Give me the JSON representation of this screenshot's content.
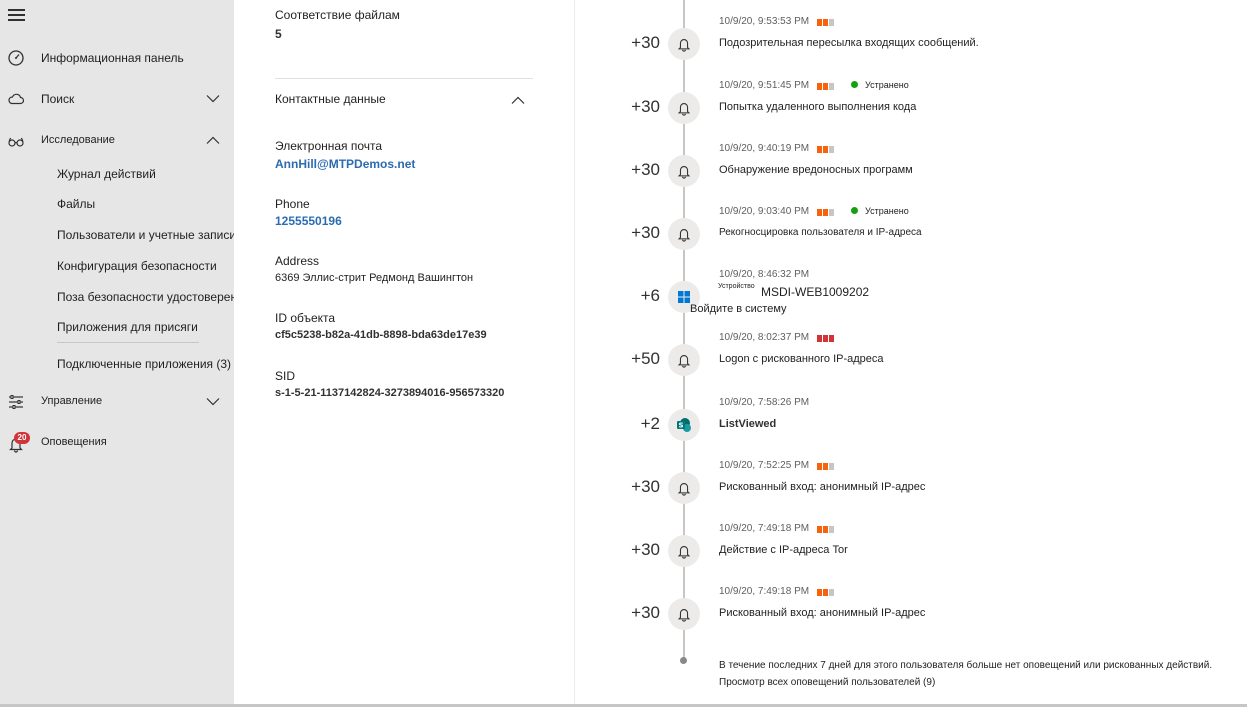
{
  "nav": {
    "items": [
      {
        "label": "Информационная панель",
        "icon": "gauge-icon"
      },
      {
        "label": "Поиск",
        "icon": "cloud-icon"
      },
      {
        "label": "Исследование",
        "icon": "glasses-icon"
      },
      {
        "label": "Управление",
        "icon": "sliders-icon"
      },
      {
        "label": "Оповещения",
        "icon": "bell-icon"
      }
    ],
    "sub_items": [
      "Журнал действий",
      "Файлы",
      "Пользователи и учетные записи",
      "Конфигурация безопасности",
      "Поза безопасности удостоверений",
      "Приложения для присяги",
      "Подключенные приложения (3)"
    ],
    "alerts_badge": "20"
  },
  "details": {
    "file_match_label": "Соответствие файлам",
    "file_match_value": "5",
    "contact_section": "Контактные данные",
    "email_label": "Электронная почта",
    "email_value": "AnnHill@MTPDemos.net",
    "phone_label": "Phone",
    "phone_value": "1255550196",
    "address_label": "Address",
    "address_value": "6369 Эллис-стрит Редмонд Вашингтон",
    "object_id_label": "ID объекта",
    "object_id_value": "cf5c5238-b82a-41db-8898-bda63de17e39",
    "sid_label": "SID",
    "sid_value": "s-1-5-21-1137142824-3273894016-956573320"
  },
  "timeline": {
    "events": [
      {
        "score": "+30",
        "time": "10/9/20, 9:53:53 PM",
        "severity": "medium",
        "status": "",
        "title": "Подозрительная пересылка входящих сообщений.",
        "icon": "bell-icon"
      },
      {
        "score": "+30",
        "time": "10/9/20, 9:51:45 PM",
        "severity": "medium",
        "status": "Устранено",
        "title": "Попытка удаленного выполнения кода",
        "icon": "bell-icon"
      },
      {
        "score": "+30",
        "time": "10/9/20, 9:40:19 PM",
        "severity": "medium",
        "status": "",
        "title": "Обнаружение вредоносных программ",
        "icon": "bell-icon"
      },
      {
        "score": "+30",
        "time": "10/9/20, 9:03:40 PM",
        "severity": "medium",
        "status": "Устранено",
        "title": "Рекогносцировка пользователя и IP-адреса",
        "icon": "bell-icon"
      },
      {
        "score": "+6",
        "time": "10/9/20, 8:46:32 PM",
        "severity": "",
        "status": "",
        "title": "",
        "icon": "windows-icon",
        "device_prefix": "Устройство",
        "device_name": "MSDI-WEB1009202",
        "device_action": "Войдите в систему"
      },
      {
        "score": "+50",
        "time": "10/9/20, 8:02:37 PM",
        "severity": "high",
        "status": "",
        "title": "Logon с рискованного IP-адреса",
        "icon": "bell-icon"
      },
      {
        "score": "+2",
        "time": "10/9/20, 7:58:26 PM",
        "severity": "",
        "status": "",
        "title": "ListViewed",
        "icon": "sharepoint-icon"
      },
      {
        "score": "+30",
        "time": "10/9/20, 7:52:25 PM",
        "severity": "medium",
        "status": "",
        "title": "Рискованный вход: анонимный IP-адрес",
        "icon": "bell-icon"
      },
      {
        "score": "+30",
        "time": "10/9/20, 7:49:18 PM",
        "severity": "medium",
        "status": "",
        "title": "Действие с IP-адреса Tor",
        "icon": "bell-icon"
      },
      {
        "score": "+30",
        "time": "10/9/20, 7:49:18 PM",
        "severity": "medium",
        "status": "",
        "title": "Рискованный вход: анонимный IP-адрес",
        "icon": "bell-icon"
      }
    ],
    "footer_text": "В течение последних 7 дней для этого пользователя больше нет оповещений или рискованных действий.",
    "footer_link": "Просмотр всех оповещений пользователей (9)"
  },
  "colors": {
    "severity_medium": "#f7630c",
    "severity_high": "#d13438",
    "severity_off": "#c8c6c4",
    "resolved_dot": "#13a10e",
    "link": "#2b6cb0"
  }
}
